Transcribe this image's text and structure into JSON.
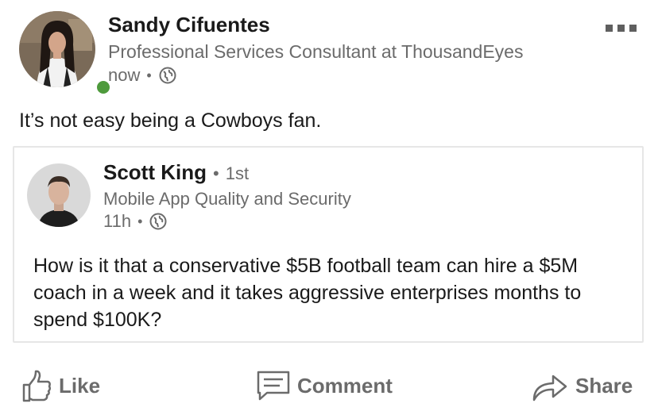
{
  "author": {
    "name": "Sandy Cifuentes",
    "headline": "Professional Services Consultant at ThousandEyes",
    "time": "now",
    "separator": "•",
    "visibility_icon": "globe-icon",
    "presence_color": "#4e9a3c",
    "online": true
  },
  "menu": {
    "icon": "more-horizontal-icon"
  },
  "post": {
    "text": "It’s not easy being a Cowboys fan."
  },
  "shared": {
    "author": {
      "name": "Scott King",
      "separator": "•",
      "degree": "1st",
      "headline": "Mobile App Quality and Security",
      "time": "11h",
      "visibility_icon": "globe-icon"
    },
    "text": "How is it that a conservative $5B football team can hire a $5M coach in a week and it takes aggressive enterprises months to spend $100K?"
  },
  "actions": {
    "like": {
      "label": "Like",
      "icon": "thumbs-up-icon"
    },
    "comment": {
      "label": "Comment",
      "icon": "comment-icon"
    },
    "share": {
      "label": "Share",
      "icon": "share-arrow-icon"
    }
  },
  "colors": {
    "text_primary": "#1a1a1a",
    "text_secondary": "#6b6b6b",
    "card_border": "#e6e6e6",
    "presence": "#4e9a3c"
  }
}
